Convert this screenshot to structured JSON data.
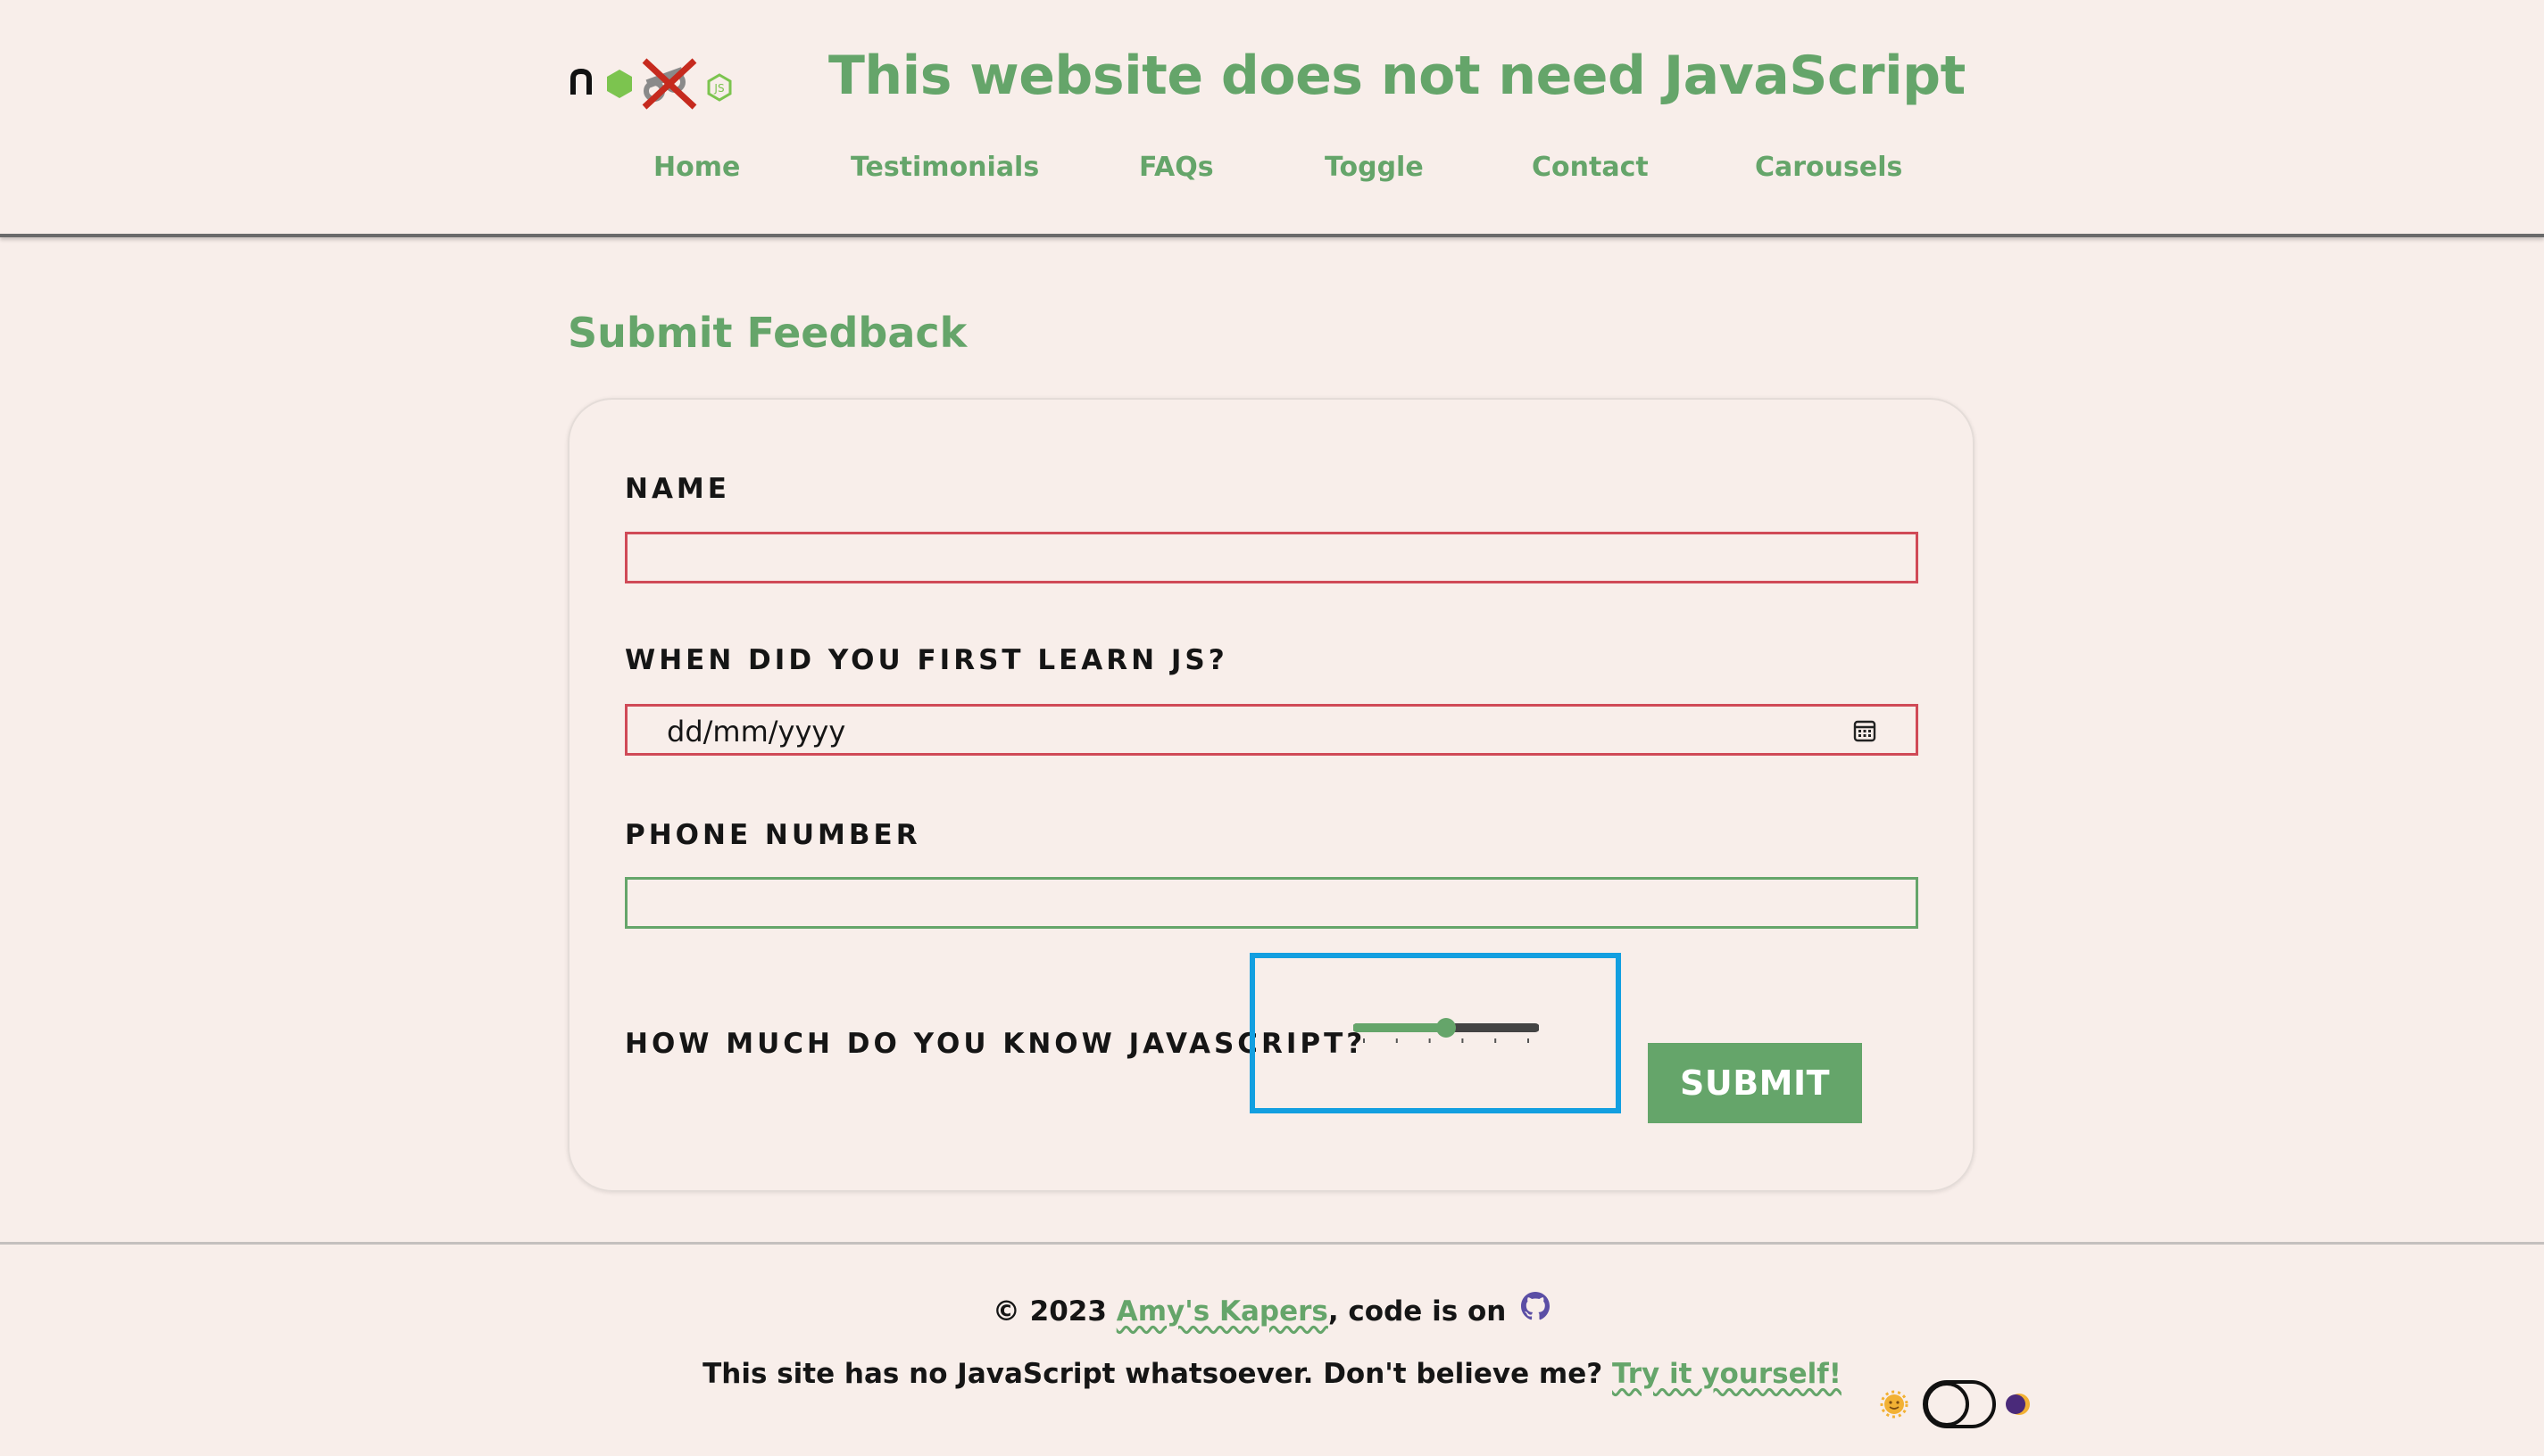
{
  "header": {
    "title": "This website does not need JavaScript",
    "logo_icons": [
      "nextjs-icon",
      "nodejs-icon",
      "crossed-out-tools-icon",
      "nodejs-small-icon"
    ],
    "nav": [
      {
        "label": "Home"
      },
      {
        "label": "Testimonials"
      },
      {
        "label": "FAQs"
      },
      {
        "label": "Toggle"
      },
      {
        "label": "Contact"
      },
      {
        "label": "Carousels"
      }
    ]
  },
  "main": {
    "heading": "Submit Feedback",
    "form": {
      "name_label": "NAME",
      "name_value": "",
      "learn_label": "WHEN DID YOU FIRST LEARN JS?",
      "learn_placeholder": "dd/mm/yyyy",
      "phone_label": "PHONE NUMBER",
      "phone_value": "",
      "knowledge_label": "HOW MUCH DO YOU KNOW JAVASCRIPT?",
      "knowledge_level_fraction": 0.5,
      "slider_ticks": 6,
      "submit_label": "SUBMIT"
    }
  },
  "footer": {
    "copyright_prefix": "© 2023 ",
    "author_link": "Amy's Kapers",
    "code_is_on": ", code is on",
    "no_js_text": "This site has no JavaScript whatsoever. Don't believe me?",
    "try_link": "Try it yourself!"
  },
  "theme_toggle": {
    "light_icon": "sun-icon",
    "dark_icon": "moon-icon",
    "state": "light"
  },
  "colors": {
    "accent": "#65a56a",
    "invalid": "#d04a57",
    "focus": "#139fe0",
    "background": "#f8eeea"
  }
}
